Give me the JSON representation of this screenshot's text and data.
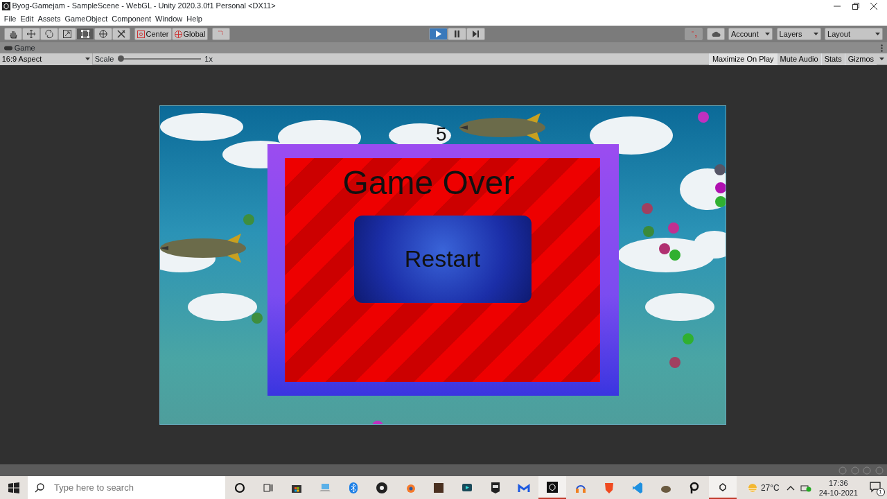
{
  "window": {
    "title": "Byog-Gamejam - SampleScene - WebGL - Unity 2020.3.0f1 Personal <DX11>"
  },
  "menu": [
    "File",
    "Edit",
    "Assets",
    "GameObject",
    "Component",
    "Window",
    "Help"
  ],
  "toolbar": {
    "tools": [
      {
        "kind": "hand",
        "selected": false
      },
      {
        "kind": "move",
        "selected": false
      },
      {
        "kind": "rotate",
        "selected": false
      },
      {
        "kind": "scale",
        "selected": false
      },
      {
        "kind": "rect",
        "selected": true
      },
      {
        "kind": "transform",
        "selected": false
      },
      {
        "kind": "custom",
        "selected": false
      }
    ],
    "pivot": [
      {
        "kind": "center",
        "label": "Center"
      },
      {
        "kind": "global",
        "label": "Global"
      }
    ],
    "play": [
      {
        "kind": "play",
        "selected": true
      },
      {
        "kind": "pause",
        "selected": false
      },
      {
        "kind": "step",
        "selected": false
      }
    ],
    "dropdowns": [
      "Account",
      "Layers",
      "Layout"
    ]
  },
  "game_tab": {
    "label": "Game"
  },
  "game_toolbar": {
    "aspect": "16:9 Aspect",
    "scale_label": "Scale",
    "scale": {
      "level": 0
    },
    "scale_reading": "1x",
    "toggles": [
      {
        "label": "Maximize On Play",
        "on": true
      },
      {
        "label": "Mute Audio",
        "on": false
      },
      {
        "label": "Stats",
        "on": false
      },
      {
        "label": "Gizmos",
        "on": false
      }
    ]
  },
  "game": {
    "score": "5",
    "title": "Game Over",
    "button": "Restart"
  },
  "taskbar": {
    "search": {
      "placeholder": "Type here to search"
    },
    "apps": [
      {
        "kind": "cortana",
        "running": false
      },
      {
        "kind": "taskview",
        "running": false
      },
      {
        "kind": "store",
        "running": false
      },
      {
        "kind": "laptop",
        "running": false
      },
      {
        "kind": "bluetooth",
        "running": false
      },
      {
        "kind": "obs",
        "running": false
      },
      {
        "kind": "blender",
        "running": false
      },
      {
        "kind": "game",
        "running": false
      },
      {
        "kind": "video",
        "running": false
      },
      {
        "kind": "epic",
        "running": false
      },
      {
        "kind": "malware",
        "running": false
      },
      {
        "kind": "unity",
        "running": true
      },
      {
        "kind": "headphones",
        "running": false
      },
      {
        "kind": "lion",
        "running": false
      },
      {
        "kind": "code",
        "running": false
      },
      {
        "kind": "gimp",
        "running": false
      },
      {
        "kind": "p",
        "running": false
      },
      {
        "kind": "unitylight",
        "running": true
      }
    ],
    "weather": "27°C",
    "time": "17:36",
    "date": "24-10-2021",
    "notifications": "1"
  }
}
